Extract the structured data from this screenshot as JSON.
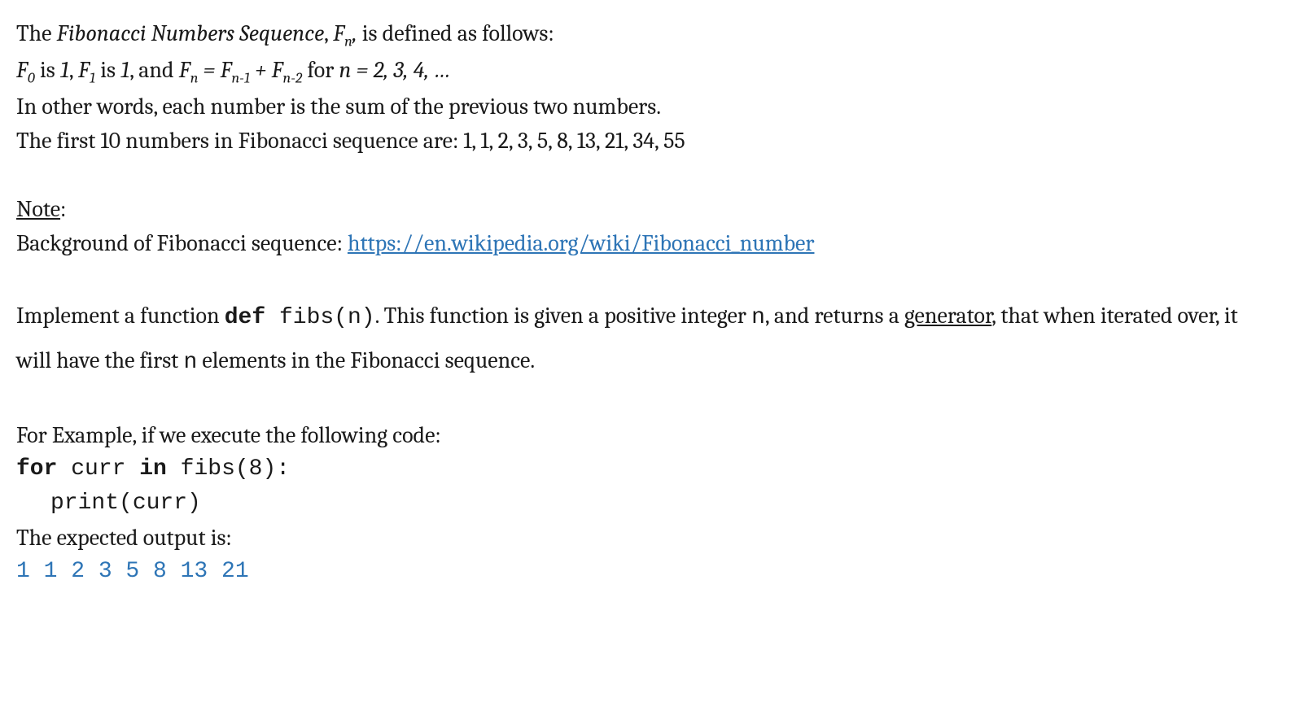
{
  "line1": {
    "part1": "The ",
    "fib_title": "Fibonacci Numbers Sequence",
    "part2": ", ",
    "fn_f": "F",
    "fn_sub": "n",
    "fn_comma": ",",
    "part3": " is defined as follows:"
  },
  "line2": {
    "f0_f": "F",
    "f0_sub": "0",
    "is_text": " is ",
    "one": "1",
    "comma1": ", ",
    "f1_f": "F",
    "f1_sub": "1",
    "is_text2": " is ",
    "one2": "1",
    "comma2": ", and ",
    "fn_f": "F",
    "fn_sub": "n",
    "eq": " = ",
    "fn1_f": "F",
    "fn1_sub": "n-1",
    "plus": " + ",
    "fn2_f": "F",
    "fn2_sub": "n-2",
    "for_text": "   for ",
    "n_eq": "n = 2, 3, 4, …"
  },
  "line3": "In other words, each number is the sum of the previous two numbers.",
  "line4": "The first 10 numbers in Fibonacci sequence are: 1, 1, 2, 3, 5, 8, 13, 21, 34, 55",
  "note_label": "Note",
  "note_colon": ":",
  "note_text": "Background of Fibonacci sequence: ",
  "note_link": "https://en.wikipedia.org/wiki/Fibonacci_number",
  "impl": {
    "part1": "Implement a function ",
    "def_kw": "def",
    "fibs_sig": "  fibs(n)",
    "part2": ". This function is given a positive integer ",
    "n_var": "n",
    "part3": ", and returns a ",
    "generator": "generator",
    "part4": ", that when iterated over, it will have the first ",
    "n_var2": "n",
    "part5": " elements in the Fibonacci sequence."
  },
  "example_intro": "For Example, if we execute the following code:",
  "code": {
    "for_kw": "for",
    "curr": " curr ",
    "in_kw": "in",
    "fibs_call": " fibs(8):",
    "print_line": "print(curr)"
  },
  "expected_label": "The expected output is:",
  "expected_output": "1 1 2 3 5 8 13 21"
}
